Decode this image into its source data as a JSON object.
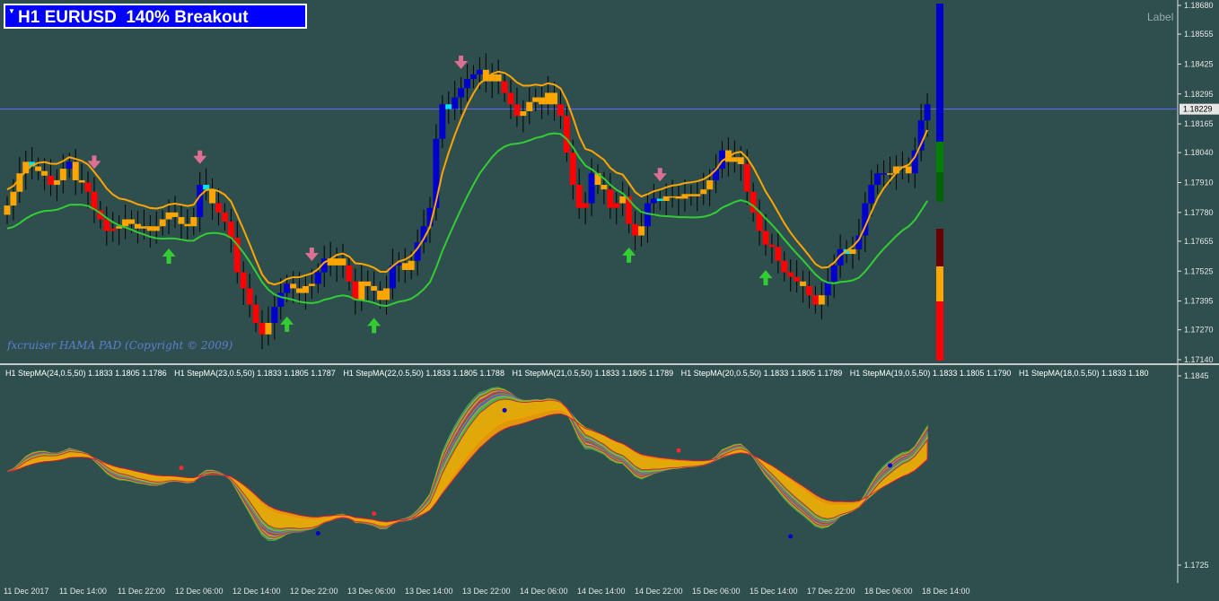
{
  "title": "H1 EURUSD  140% Breakout",
  "label_text": "Label",
  "copyright": "fxcruiser HAMA PAD (Copyright © 2009)",
  "current_price": "1.18229",
  "price_axis": [
    "1.18680",
    "1.18555",
    "1.18425",
    "1.18295",
    "1.18165",
    "1.18040",
    "1.17910",
    "1.17780",
    "1.17655",
    "1.17525",
    "1.17395",
    "1.17270",
    "1.17140"
  ],
  "sub_axis": [
    "1.1845",
    "1.1725"
  ],
  "indicator_headers": [
    "H1 StepMA(24,0.5,50) 1.1833 1.1805 1.1786",
    "H1 StepMA(23,0.5,50) 1.1833 1.1805 1.1787",
    "H1 StepMA(22,0.5,50) 1.1833 1.1805 1.1788",
    "H1 StepMA(21,0.5,50) 1.1833 1.1805 1.1789",
    "H1 StepMA(20,0.5,50) 1.1833 1.1805 1.1789",
    "H1 StepMA(19,0.5,50) 1.1833 1.1805 1.1790",
    "H1 StepMA(18,0.5,50) 1.1833 1.180"
  ],
  "time_axis": [
    "11 Dec 2017",
    "11 Dec 14:00",
    "11 Dec 22:00",
    "12 Dec 06:00",
    "12 Dec 14:00",
    "12 Dec 22:00",
    "13 Dec 06:00",
    "13 Dec 14:00",
    "13 Dec 22:00",
    "14 Dec 06:00",
    "14 Dec 14:00",
    "14 Dec 22:00",
    "15 Dec 06:00",
    "15 Dec 14:00",
    "17 Dec 22:00",
    "18 Dec 06:00",
    "18 Dec 14:00"
  ],
  "colors": {
    "background": "#2f4f4f",
    "bull": "#0000cd",
    "bull_light": "#00e5ee",
    "bear": "#ff0000",
    "neutral": "#ffa500",
    "signal_green": "#32cd32",
    "signal_orange": "#ffa500",
    "arrow_down": "#db7093",
    "arrow_up": "#32cd32",
    "level_line": "#6a6aff"
  },
  "chart_data": {
    "type": "candlestick",
    "symbol": "EURUSD",
    "timeframe": "H1",
    "ylim": [
      1.1714,
      1.1868
    ],
    "closes": [
      1.1781,
      1.1787,
      1.1795,
      1.18,
      1.1798,
      1.1796,
      1.1794,
      1.179,
      1.1792,
      1.1797,
      1.18,
      1.1792,
      1.1791,
      1.1787,
      1.1779,
      1.1775,
      1.177,
      1.1771,
      1.1772,
      1.1775,
      1.1773,
      1.1771,
      1.1772,
      1.177,
      1.1772,
      1.1775,
      1.1778,
      1.1776,
      1.1773,
      1.1772,
      1.1776,
      1.179,
      1.1788,
      1.1782,
      1.1778,
      1.1774,
      1.1767,
      1.1752,
      1.1745,
      1.1738,
      1.173,
      1.1725,
      1.173,
      1.1737,
      1.1743,
      1.1747,
      1.1745,
      1.1743,
      1.1746,
      1.1747,
      1.1752,
      1.1758,
      1.1755,
      1.1758,
      1.1755,
      1.1748,
      1.174,
      1.1748,
      1.1746,
      1.1744,
      1.174,
      1.1745,
      1.1755,
      1.1756,
      1.1753,
      1.1757,
      1.1765,
      1.1772,
      1.178,
      1.181,
      1.1825,
      1.1823,
      1.1828,
      1.1832,
      1.1836,
      1.1838,
      1.184,
      1.1835,
      1.1838,
      1.1835,
      1.183,
      1.1825,
      1.182,
      1.1822,
      1.1826,
      1.1828,
      1.1825,
      1.183,
      1.1825,
      1.182,
      1.1804,
      1.179,
      1.178,
      1.1782,
      1.1795,
      1.179,
      1.1788,
      1.178,
      1.1782,
      1.1785,
      1.1773,
      1.1768,
      1.1772,
      1.1782,
      1.1784,
      1.1783,
      1.1785,
      1.1785,
      1.1784,
      1.1786,
      1.1785,
      1.1786,
      1.1788,
      1.1792,
      1.1797,
      1.1805,
      1.18,
      1.1802,
      1.1799,
      1.1787,
      1.1778,
      1.177,
      1.1764,
      1.1763,
      1.1757,
      1.1752,
      1.175,
      1.1748,
      1.1746,
      1.1742,
      1.1738,
      1.1742,
      1.1748,
      1.1755,
      1.1762,
      1.176,
      1.1762,
      1.1768,
      1.1782,
      1.179,
      1.1795,
      1.1795,
      1.1795,
      1.1798,
      1.1798,
      1.1795,
      1.1805,
      1.1818,
      1.1825
    ]
  }
}
